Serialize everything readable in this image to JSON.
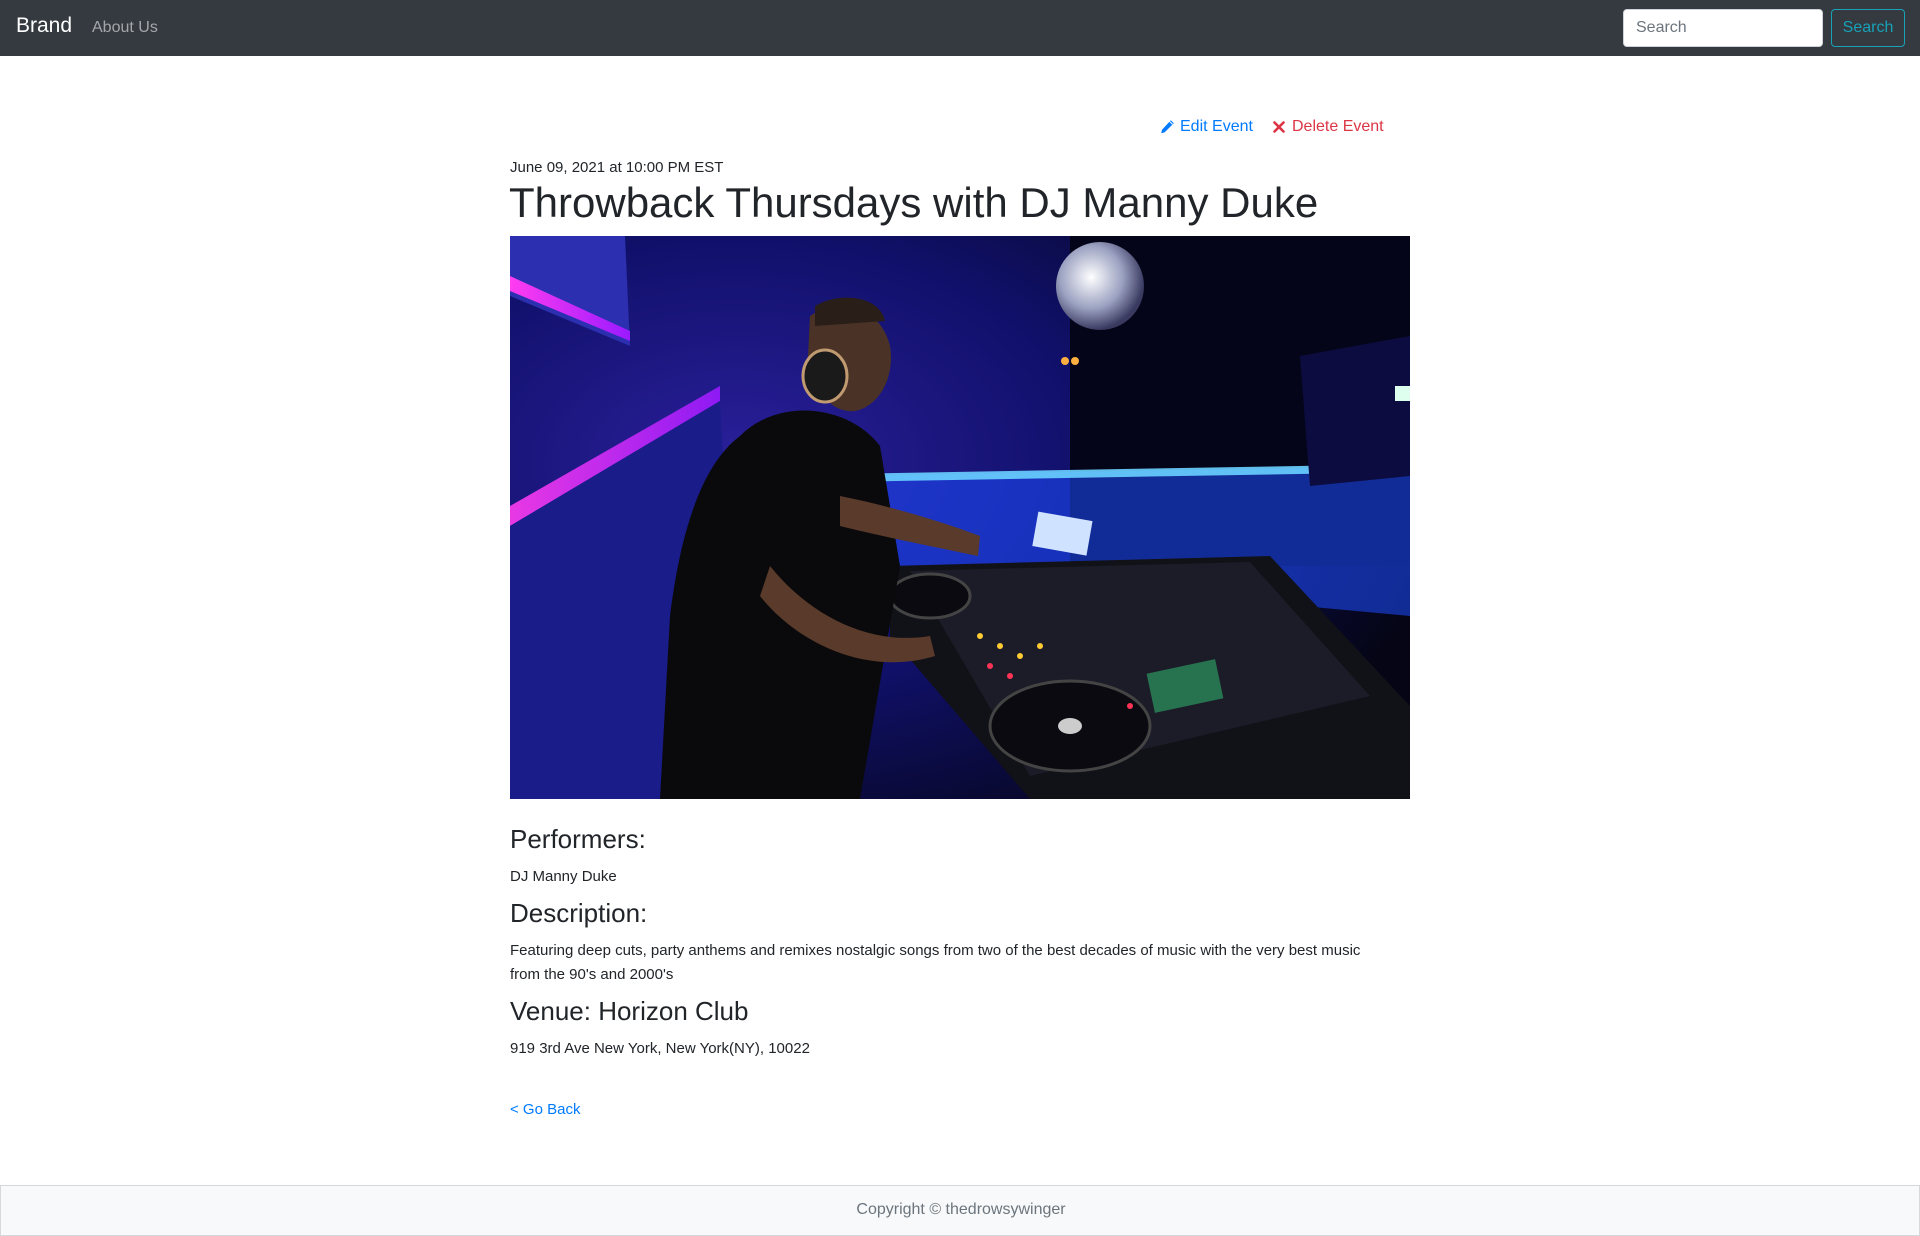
{
  "navbar": {
    "brand": "Brand",
    "links": [
      {
        "label": "About Us"
      }
    ],
    "search": {
      "placeholder": "Search",
      "value": "",
      "button_label": "Search"
    }
  },
  "actions": {
    "edit_label": "Edit Event",
    "delete_label": "Delete Event"
  },
  "event": {
    "datetime": "June 09, 2021 at 10:00 PM EST",
    "title": "Throwback Thursdays with DJ Manny Duke",
    "performers_heading": "Performers:",
    "performers": "DJ Manny Duke",
    "description_heading": "Description:",
    "description": "Featuring deep cuts, party anthems and remixes nostalgic songs from two of the best decades of music with the very best music from the 90's and 2000's",
    "venue_heading": "Venue: Horizon Club",
    "venue_address": "919 3rd Ave New York, New York(NY), 10022"
  },
  "go_back_label": "< Go Back",
  "footer": {
    "copyright": "Copyright © thedrowsywinger"
  },
  "colors": {
    "navbar_bg": "#343a40",
    "link": "#007bff",
    "danger": "#dc3545",
    "search_outline": "#17a2b8",
    "footer_bg": "#f8f9fa"
  },
  "icons": {
    "edit": "pencil-icon",
    "delete": "close-icon"
  }
}
